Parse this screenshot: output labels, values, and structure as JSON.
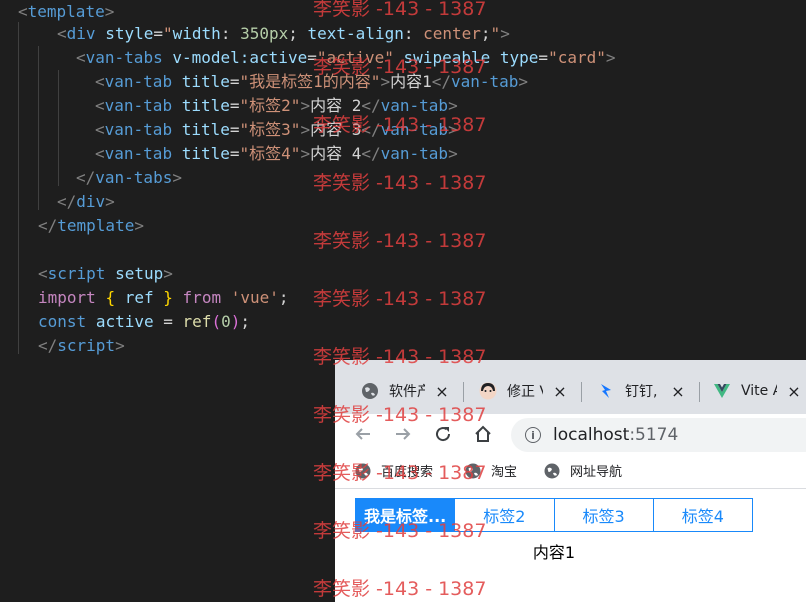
{
  "code": {
    "lines": {
      "l1": {
        "open": "<",
        "tag": "template",
        "close": ">"
      },
      "l2": {
        "open": "<",
        "tag": "div",
        "attr1": "style",
        "eq": "=",
        "q1": "\"",
        "v1a": "width",
        "v1b": ": ",
        "v1c": "350px",
        "v1d": "; ",
        "v1e": "text-align",
        "v1f": ": ",
        "v1g": "center",
        "v1h": ";",
        "q2": "\"",
        "close": ">"
      },
      "l3": {
        "open": "<",
        "tag": "van-tabs",
        "attr1": "v-model:active",
        "eq1": "=",
        "v1": "\"active\"",
        "attr2": "swipeable",
        "attr3": "type",
        "eq3": "=",
        "v3": "\"card\"",
        "close": ">"
      },
      "l4": {
        "open": "<",
        "tag": "van-tab",
        "attr": "title",
        "eq": "=",
        "val": "\"我是标签1的内容\"",
        "close": ">",
        "text": "内容1",
        "endopen": "</",
        "endtag": "van-tab",
        "endclose": ">"
      },
      "l5": {
        "open": "<",
        "tag": "van-tab",
        "attr": "title",
        "eq": "=",
        "val": "\"标签2\"",
        "close": ">",
        "text": "内容 2",
        "endopen": "</",
        "endtag": "van-tab",
        "endclose": ">"
      },
      "l6": {
        "open": "<",
        "tag": "van-tab",
        "attr": "title",
        "eq": "=",
        "val": "\"标签3\"",
        "close": ">",
        "text": "内容 3",
        "endopen": "</",
        "endtag": "van-tab",
        "endclose": ">"
      },
      "l7": {
        "open": "<",
        "tag": "van-tab",
        "attr": "title",
        "eq": "=",
        "val": "\"标签4\"",
        "close": ">",
        "text": "内容 4",
        "endopen": "</",
        "endtag": "van-tab",
        "endclose": ">"
      },
      "l8": {
        "open": "</",
        "tag": "van-tabs",
        "close": ">"
      },
      "l9": {
        "open": "</",
        "tag": "div",
        "close": ">"
      },
      "l10": {
        "open": "</",
        "tag": "template",
        "close": ">"
      },
      "l12": {
        "open": "<",
        "tag": "script",
        "attr": "setup",
        "close": ">"
      },
      "l13": {
        "kw": "import",
        "lb": "{",
        "name": "ref",
        "rb": "}",
        "from": "from",
        "mod": "'vue'",
        "semi": ";"
      },
      "l14": {
        "kw": "const",
        "name": "active",
        "eq": "=",
        "fn": "ref",
        "lp": "(",
        "num": "0",
        "rp": ")",
        "semi": ";"
      },
      "l15": {
        "open": "</",
        "tag": "script",
        "close": ">"
      }
    }
  },
  "browser": {
    "tabs": [
      {
        "title": "软件产",
        "icon": "globe-icon",
        "close": "×"
      },
      {
        "title": "修正 V",
        "icon": "avatar-icon",
        "close": "×"
      },
      {
        "title": "钉钉,",
        "icon": "dingtalk-icon",
        "close": "×"
      },
      {
        "title": "Vite A",
        "icon": "vue-icon",
        "close": "×"
      }
    ],
    "address": {
      "host": "localhost",
      "port": ":5174"
    },
    "bookmarks": [
      {
        "label": "百度搜索",
        "icon": "globe-icon"
      },
      {
        "label": "淘宝",
        "icon": "globe-icon"
      },
      {
        "label": "网址导航",
        "icon": "globe-icon"
      }
    ],
    "page": {
      "tabs": [
        "我是标签...",
        "标签2",
        "标签3",
        "标签4"
      ],
      "active_index": 0,
      "content": "内容1"
    }
  },
  "watermark": {
    "text": "李笑影 -143 - 1387"
  },
  "colors": {
    "accent": "#1989fa",
    "editor_bg": "#1e1e1e",
    "watermark": "#e04040"
  }
}
